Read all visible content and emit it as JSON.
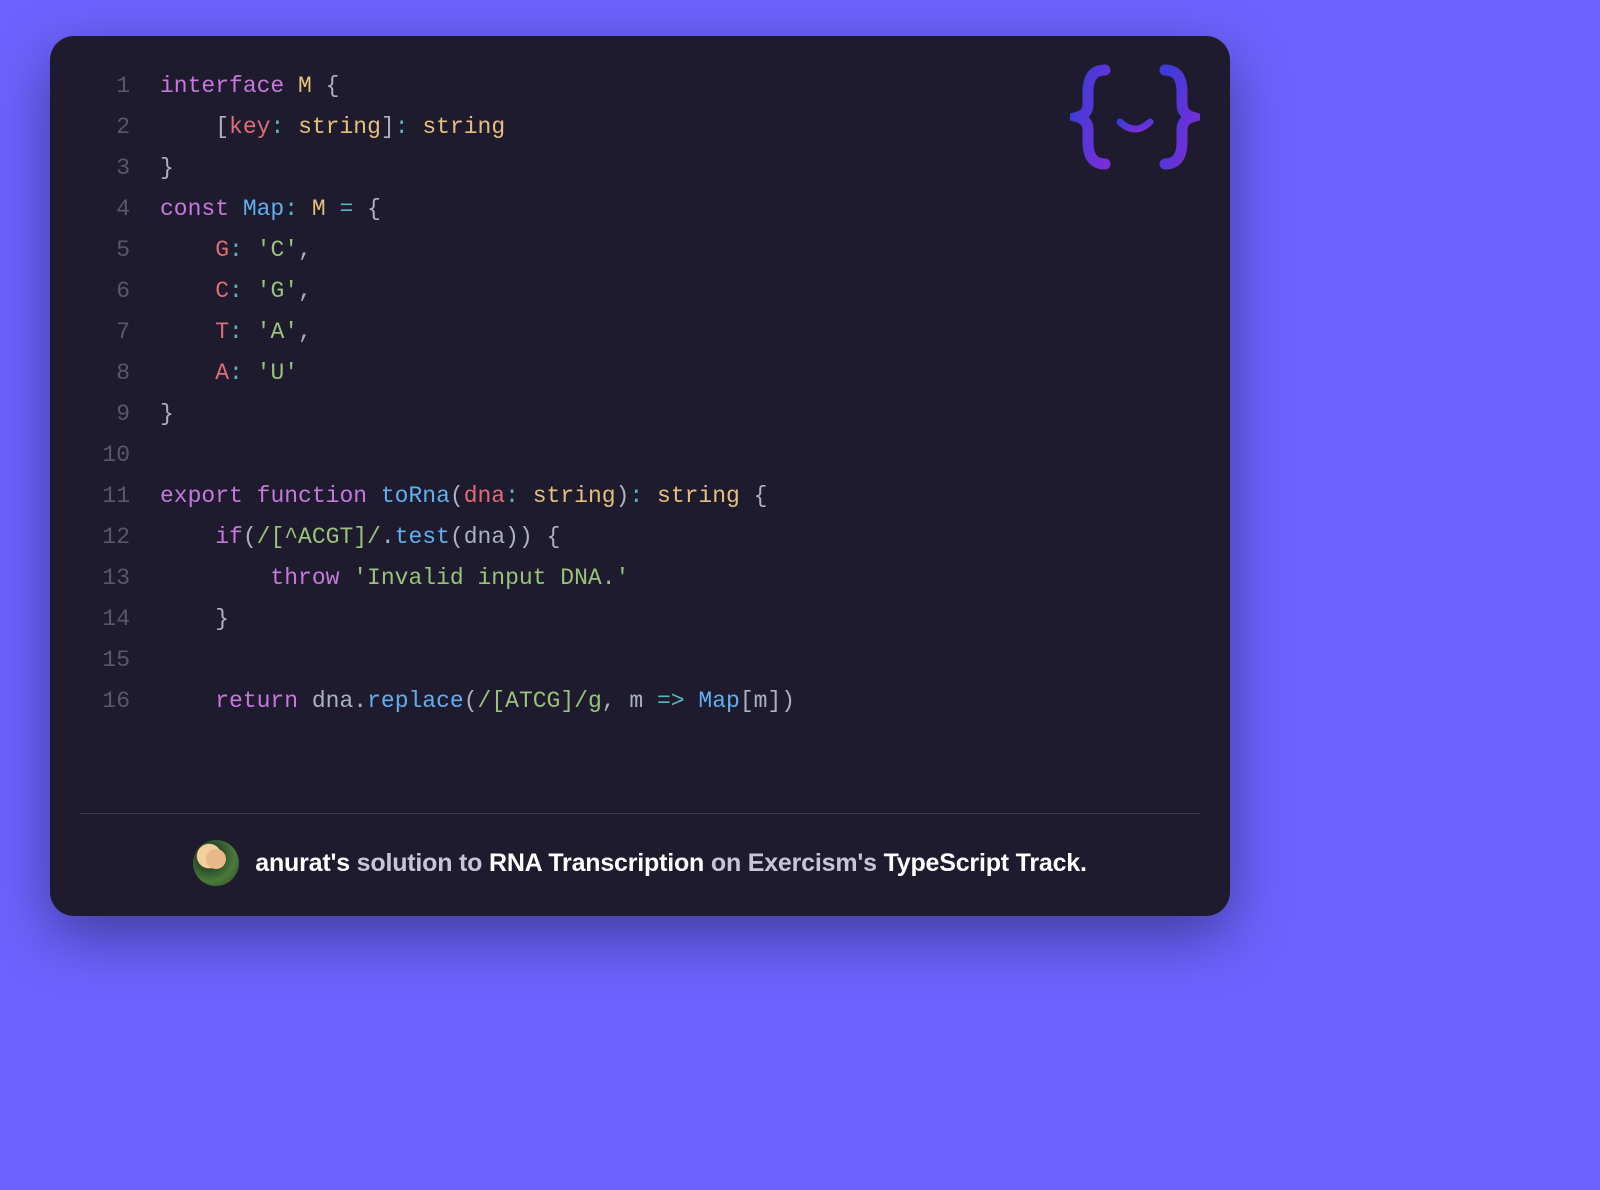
{
  "code": {
    "lines": [
      {
        "n": 1,
        "tokens": [
          [
            "kw",
            "interface"
          ],
          [
            "plain",
            " "
          ],
          [
            "type",
            "M"
          ],
          [
            "plain",
            " "
          ],
          [
            "punct",
            "{"
          ]
        ]
      },
      {
        "n": 2,
        "tokens": [
          [
            "plain",
            "    "
          ],
          [
            "punct",
            "["
          ],
          [
            "var",
            "key"
          ],
          [
            "op",
            ":"
          ],
          [
            "plain",
            " "
          ],
          [
            "type",
            "string"
          ],
          [
            "punct",
            "]"
          ],
          [
            "op",
            ":"
          ],
          [
            "plain",
            " "
          ],
          [
            "type",
            "string"
          ]
        ]
      },
      {
        "n": 3,
        "tokens": [
          [
            "punct",
            "}"
          ]
        ]
      },
      {
        "n": 4,
        "tokens": [
          [
            "kw",
            "const"
          ],
          [
            "plain",
            " "
          ],
          [
            "ident",
            "Map"
          ],
          [
            "op",
            ":"
          ],
          [
            "plain",
            " "
          ],
          [
            "type",
            "M"
          ],
          [
            "plain",
            " "
          ],
          [
            "op",
            "="
          ],
          [
            "plain",
            " "
          ],
          [
            "punct",
            "{"
          ]
        ]
      },
      {
        "n": 5,
        "tokens": [
          [
            "plain",
            "    "
          ],
          [
            "var",
            "G"
          ],
          [
            "op",
            ":"
          ],
          [
            "plain",
            " "
          ],
          [
            "str",
            "'C'"
          ],
          [
            "punct",
            ","
          ]
        ]
      },
      {
        "n": 6,
        "tokens": [
          [
            "plain",
            "    "
          ],
          [
            "var",
            "C"
          ],
          [
            "op",
            ":"
          ],
          [
            "plain",
            " "
          ],
          [
            "str",
            "'G'"
          ],
          [
            "punct",
            ","
          ]
        ]
      },
      {
        "n": 7,
        "tokens": [
          [
            "plain",
            "    "
          ],
          [
            "var",
            "T"
          ],
          [
            "op",
            ":"
          ],
          [
            "plain",
            " "
          ],
          [
            "str",
            "'A'"
          ],
          [
            "punct",
            ","
          ]
        ]
      },
      {
        "n": 8,
        "tokens": [
          [
            "plain",
            "    "
          ],
          [
            "var",
            "A"
          ],
          [
            "op",
            ":"
          ],
          [
            "plain",
            " "
          ],
          [
            "str",
            "'U'"
          ]
        ]
      },
      {
        "n": 9,
        "tokens": [
          [
            "punct",
            "}"
          ]
        ]
      },
      {
        "n": 10,
        "tokens": []
      },
      {
        "n": 11,
        "tokens": [
          [
            "kw",
            "export"
          ],
          [
            "plain",
            " "
          ],
          [
            "kw",
            "function"
          ],
          [
            "plain",
            " "
          ],
          [
            "fn",
            "toRna"
          ],
          [
            "punct",
            "("
          ],
          [
            "var",
            "dna"
          ],
          [
            "op",
            ":"
          ],
          [
            "plain",
            " "
          ],
          [
            "type",
            "string"
          ],
          [
            "punct",
            ")"
          ],
          [
            "op",
            ":"
          ],
          [
            "plain",
            " "
          ],
          [
            "type",
            "string"
          ],
          [
            "plain",
            " "
          ],
          [
            "punct",
            "{"
          ]
        ]
      },
      {
        "n": 12,
        "tokens": [
          [
            "plain",
            "    "
          ],
          [
            "kw",
            "if"
          ],
          [
            "punct",
            "("
          ],
          [
            "str",
            "/[^ACGT]/"
          ],
          [
            "punct",
            "."
          ],
          [
            "fn",
            "test"
          ],
          [
            "punct",
            "("
          ],
          [
            "plain",
            "dna"
          ],
          [
            "punct",
            "))"
          ],
          [
            "plain",
            " "
          ],
          [
            "punct",
            "{"
          ]
        ]
      },
      {
        "n": 13,
        "tokens": [
          [
            "plain",
            "        "
          ],
          [
            "kw",
            "throw"
          ],
          [
            "plain",
            " "
          ],
          [
            "str",
            "'Invalid input DNA.'"
          ]
        ]
      },
      {
        "n": 14,
        "tokens": [
          [
            "plain",
            "    "
          ],
          [
            "punct",
            "}"
          ]
        ]
      },
      {
        "n": 15,
        "tokens": []
      },
      {
        "n": 16,
        "tokens": [
          [
            "plain",
            "    "
          ],
          [
            "kw",
            "return"
          ],
          [
            "plain",
            " "
          ],
          [
            "plain",
            "dna"
          ],
          [
            "punct",
            "."
          ],
          [
            "fn",
            "replace"
          ],
          [
            "punct",
            "("
          ],
          [
            "str",
            "/[ATCG]/g"
          ],
          [
            "punct",
            ","
          ],
          [
            "plain",
            " m "
          ],
          [
            "op",
            "=>"
          ],
          [
            "plain",
            " "
          ],
          [
            "ident",
            "Map"
          ],
          [
            "punct",
            "["
          ],
          [
            "plain",
            "m"
          ],
          [
            "punct",
            "])"
          ]
        ]
      }
    ]
  },
  "footer": {
    "prefix_user": "anurat's",
    "solution_word": " solution to ",
    "exercise": "RNA Transcription",
    "on_word": " on Exercism's ",
    "track": "TypeScript Track."
  },
  "logo_name": "exercism-logo"
}
